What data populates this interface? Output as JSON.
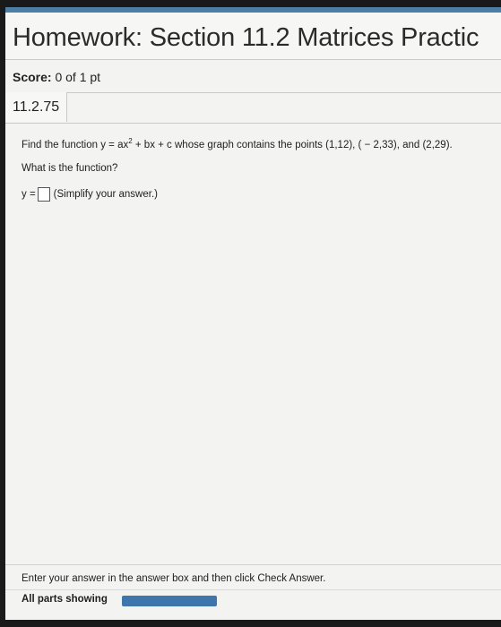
{
  "header": {
    "title": "Homework: Section 11.2 Matrices Practic",
    "accent_color": "#4b7fa6"
  },
  "score": {
    "label": "Score:",
    "value": "0 of 1 pt"
  },
  "question": {
    "number": "11.2.75",
    "text_before_exponent": "Find the function y = ax",
    "exponent": "2",
    "text_after_exponent": " + bx + c whose graph contains the points (1,12), ( − 2,33), and (2,29).",
    "prompt": "What is the function?",
    "answer_prefix": "y =",
    "answer_value": "",
    "answer_hint": "(Simplify your answer.)"
  },
  "footer": {
    "instruction": "Enter your answer in the answer box and then click Check Answer.",
    "parts_label": "All parts showing",
    "progress_fraction": 1.0,
    "progress_color": "#3f75ad"
  }
}
